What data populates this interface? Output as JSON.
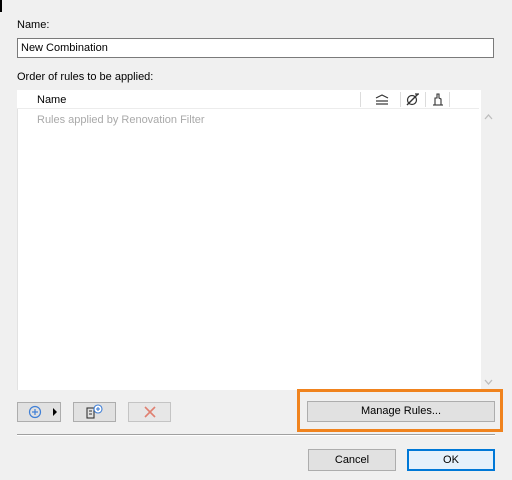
{
  "name_field": {
    "label": "Name:",
    "value": "New Combination"
  },
  "rules_list": {
    "label": "Order of rules to be applied:",
    "column_name": "Name",
    "header_icons": [
      "layers-icon",
      "override-icon",
      "hand-icon"
    ],
    "placeholder_row": "Rules applied by Renovation Filter"
  },
  "toolbar": {
    "add_icon": "plus-circle-icon",
    "add_dropdown_icon": "triangle-right-icon",
    "add_rule_icon": "add-rule-icon",
    "delete_icon": "red-x-icon"
  },
  "buttons": {
    "manage_rules": "Manage Rules...",
    "cancel": "Cancel",
    "ok": "OK"
  },
  "colors": {
    "highlight": "#f0831e",
    "default_button_border": "#0078d7",
    "add_icon": "#3f7fd6",
    "delete_icon": "#e08070"
  }
}
